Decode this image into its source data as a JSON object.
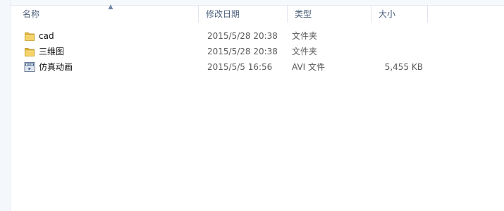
{
  "columns": {
    "name": "名称",
    "modified": "修改日期",
    "type": "类型",
    "size": "大小"
  },
  "sort": {
    "column": "name",
    "icon": "sort-up-caret-icon"
  },
  "files": [
    {
      "name": "cad",
      "modified": "2015/5/28 20:38",
      "type": "文件夹",
      "size": "",
      "icon": "folder-icon"
    },
    {
      "name": "三维图",
      "modified": "2015/5/28 20:38",
      "type": "文件夹",
      "size": "",
      "icon": "folder-icon"
    },
    {
      "name": "仿真动画",
      "modified": "2015/5/5 16:56",
      "type": "AVI 文件",
      "size": "5,455 KB",
      "icon": "avi-video-file-icon"
    }
  ]
}
